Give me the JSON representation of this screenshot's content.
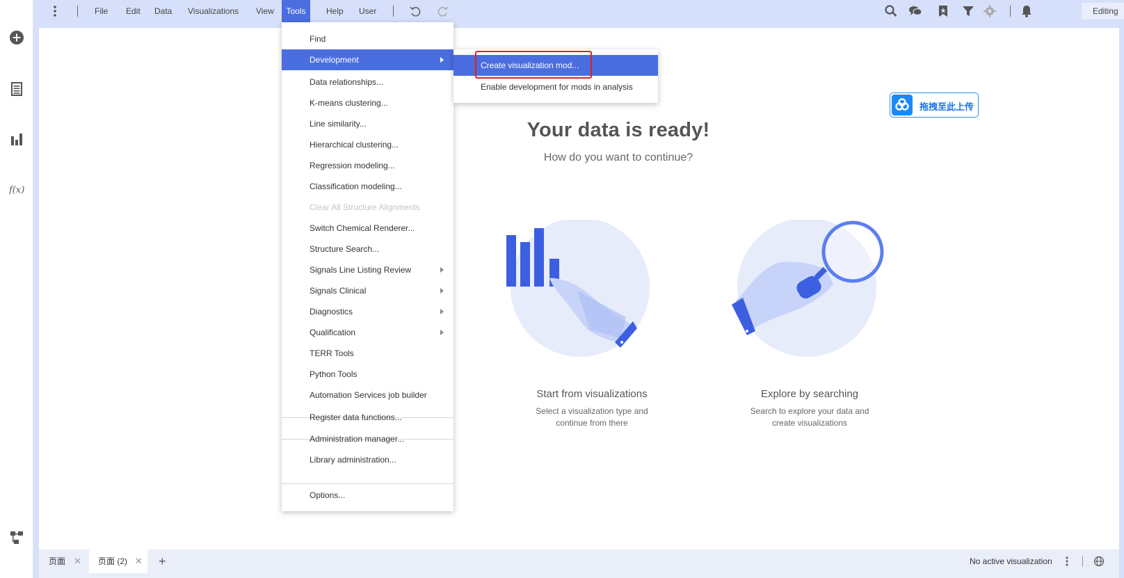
{
  "menubar": {
    "items": [
      "File",
      "Edit",
      "Data",
      "Visualizations",
      "View",
      "Tools",
      "Help",
      "User"
    ],
    "active": "Tools",
    "mode_label": "Editing"
  },
  "tools_menu": {
    "items": [
      {
        "label": "Find"
      },
      {
        "label": "Development",
        "submenu": true,
        "highlighted": true
      },
      {
        "label": "Data relationships..."
      },
      {
        "label": "K-means clustering..."
      },
      {
        "label": "Line similarity..."
      },
      {
        "label": "Hierarchical clustering..."
      },
      {
        "label": "Regression modeling..."
      },
      {
        "label": "Classification modeling..."
      },
      {
        "label": "Clear All Structure Alignments",
        "disabled": true
      },
      {
        "label": "Switch Chemical Renderer..."
      },
      {
        "label": "Structure Search..."
      },
      {
        "label": "Signals Line Listing Review",
        "submenu": true
      },
      {
        "label": "Signals Clinical",
        "submenu": true
      },
      {
        "label": "Diagnostics",
        "submenu": true
      },
      {
        "label": "Qualification",
        "submenu": true
      },
      {
        "label": "TERR Tools"
      },
      {
        "label": "Python Tools"
      },
      {
        "label": "Automation Services job builder"
      },
      {
        "label": "Register data functions..."
      },
      {
        "label": "Administration manager..."
      },
      {
        "label": "Library administration..."
      },
      {
        "label": "Options..."
      }
    ]
  },
  "development_submenu": {
    "items": [
      {
        "label": "Create visualization mod...",
        "highlighted": true
      },
      {
        "label": "Enable development for mods in analysis"
      }
    ]
  },
  "hero": {
    "title": "Your data is ready!",
    "subtitle": "How do you want to continue?"
  },
  "cards": [
    {
      "title": "Start from visualizations",
      "desc_line1": "Select a visualization type and",
      "desc_line2": "continue from there"
    },
    {
      "title": "Explore by searching",
      "desc_line1": "Search to explore your data and",
      "desc_line2": "create visualizations"
    }
  ],
  "upload_button": {
    "label": "拖拽至此上传"
  },
  "bottom": {
    "tabs": [
      {
        "label": "页面"
      },
      {
        "label": "页面 (2)",
        "active": true
      }
    ],
    "status": "No active visualization"
  },
  "colors": {
    "accent": "#4a6ee0",
    "chrome": "#d7e0fa",
    "illustration": "#3b5fe0",
    "highlight_box": "#e02020"
  },
  "icons": {
    "menubar_right": [
      "search-icon",
      "comments-icon",
      "bookmark-icon",
      "filter-icon",
      "gear-icon",
      "bell-icon"
    ],
    "left_rail": [
      "add-circle-icon",
      "data-table-icon",
      "bar-chart-icon",
      "function-icon",
      "hierarchy-icon"
    ]
  }
}
